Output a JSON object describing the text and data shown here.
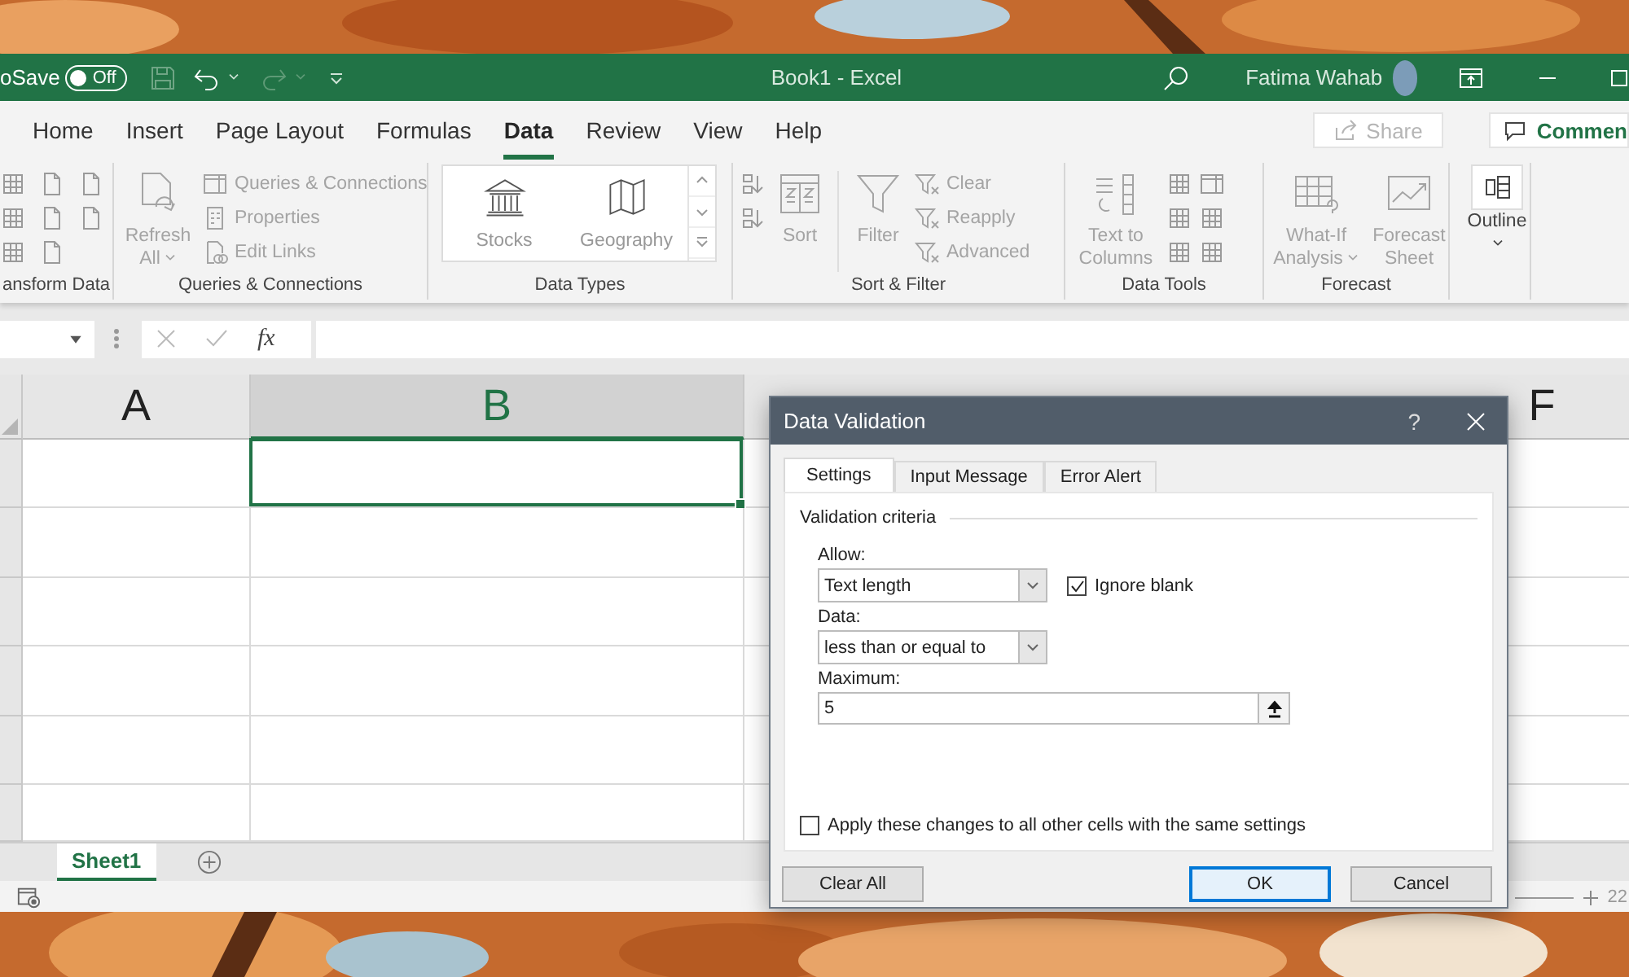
{
  "title_bar": {
    "autosave_label": "oSave",
    "autosave": {
      "label": "Off",
      "on": false
    },
    "document_title": "Book1 - Excel",
    "user_name": "Fatima Wahab"
  },
  "ribbon_tabs": [
    {
      "label": "Home",
      "selected": false
    },
    {
      "label": "Insert",
      "selected": false
    },
    {
      "label": "Page Layout",
      "selected": false
    },
    {
      "label": "Formulas",
      "selected": false
    },
    {
      "label": "Data",
      "selected": true
    },
    {
      "label": "Review",
      "selected": false
    },
    {
      "label": "View",
      "selected": false
    },
    {
      "label": "Help",
      "selected": false
    }
  ],
  "share_button": {
    "label": "Share",
    "disabled": true
  },
  "comments_button": {
    "label": "Commen"
  },
  "ribbon_groups": [
    {
      "kind": "get-transform",
      "label": "ansform Data"
    },
    {
      "kind": "queries",
      "label": "Queries & Connections",
      "large": [
        {
          "label": "Refresh All",
          "disabled": true
        }
      ],
      "small": [
        {
          "label": "Queries & Connections",
          "disabled": true
        },
        {
          "label": "Properties",
          "disabled": true
        },
        {
          "label": "Edit Links",
          "disabled": true
        }
      ]
    },
    {
      "kind": "data-types",
      "label": "Data Types",
      "gallery": [
        {
          "label": "Stocks"
        },
        {
          "label": "Geography"
        }
      ]
    },
    {
      "kind": "sort-filter",
      "label": "Sort & Filter",
      "large": [
        {
          "label": "Sort",
          "disabled": true
        },
        {
          "label": "Filter",
          "disabled": true
        }
      ],
      "small": [
        {
          "label": "Clear",
          "disabled": true
        },
        {
          "label": "Reapply",
          "disabled": true
        },
        {
          "label": "Advanced",
          "disabled": true
        }
      ]
    },
    {
      "kind": "data-tools",
      "label": "Data Tools",
      "large": [
        {
          "label": "Text to Columns",
          "disabled": true
        }
      ]
    },
    {
      "kind": "forecast",
      "label": "Forecast",
      "large": [
        {
          "label": "What-If Analysis",
          "disabled": true
        },
        {
          "label": "Forecast Sheet",
          "disabled": true
        }
      ]
    },
    {
      "kind": "outline",
      "large": [
        {
          "label": "Outline",
          "disabled": false
        }
      ]
    }
  ],
  "formula_bar": {
    "function_label": "fx"
  },
  "sheet": {
    "columns": [
      {
        "label": "A",
        "selected": false
      },
      {
        "label": "B",
        "selected": true
      },
      {
        "label": "F",
        "selected": false
      }
    ]
  },
  "sheet_tabs": [
    {
      "label": "Sheet1",
      "selected": true
    }
  ],
  "status_bar": {
    "zoom": "22"
  },
  "dialog": {
    "title": "Data Validation",
    "help": "?",
    "tabs": [
      {
        "label": "Settings",
        "selected": true
      },
      {
        "label": "Input Message",
        "selected": false
      },
      {
        "label": "Error Alert",
        "selected": false
      }
    ],
    "section_label": "Validation criteria",
    "fields": [
      {
        "kind": "select",
        "label": "Allow:",
        "value": "Text length"
      },
      {
        "kind": "checkbox",
        "label": "Ignore blank",
        "checked": true
      },
      {
        "kind": "select",
        "label": "Data:",
        "value": "less than or equal to"
      },
      {
        "kind": "input",
        "label": "Maximum:",
        "value": "5"
      }
    ],
    "apply_all": {
      "label": "Apply these changes to all other cells with the same settings",
      "checked": false
    },
    "buttons": [
      {
        "label": "Clear All",
        "kind": "secondary"
      },
      {
        "label": "OK",
        "kind": "default"
      },
      {
        "label": "Cancel",
        "kind": "secondary"
      }
    ]
  }
}
